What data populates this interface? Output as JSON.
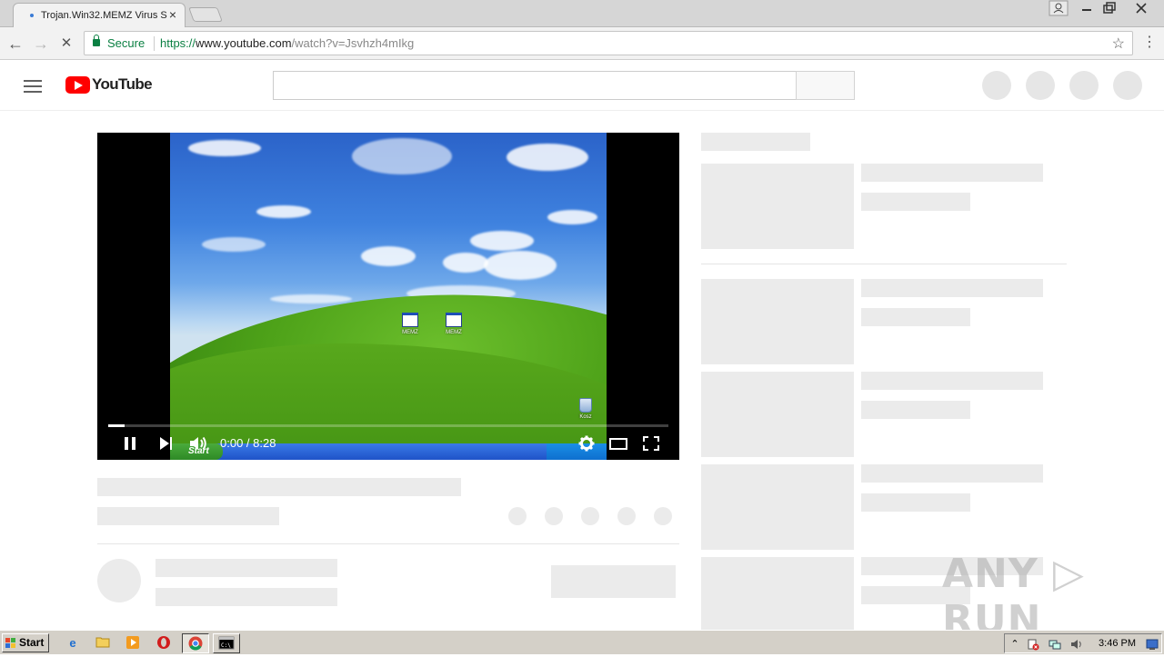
{
  "browser": {
    "tab_title": "Trojan.Win32.MEMZ Virus S",
    "tab_close": "×",
    "secure_label": "Secure",
    "url_scheme": "https://",
    "url_host": "www.youtube.com",
    "url_path": "/watch?v=Jsvhzh4mIkg",
    "bookmark_star": "☆",
    "menu": "⋮",
    "back": "←",
    "forward": "→",
    "stop": "✕"
  },
  "youtube": {
    "logo_text": "YouTube",
    "search_placeholder": ""
  },
  "player": {
    "time_display": "0:00 / 8:28",
    "progress_fraction": 0.03,
    "desktop_icons": [
      {
        "label": "MEMZ"
      },
      {
        "label": "MEMZ"
      }
    ],
    "recycle_label": "Kosz",
    "xp_start_label": "Start"
  },
  "taskbar": {
    "start_label": "Start",
    "clock": "3:46 PM"
  },
  "watermark": "ANY ▷ RUN",
  "colors": {
    "youtube_red": "#ff0000",
    "secure_green": "#0b8043",
    "placeholder": "#ebebeb"
  }
}
